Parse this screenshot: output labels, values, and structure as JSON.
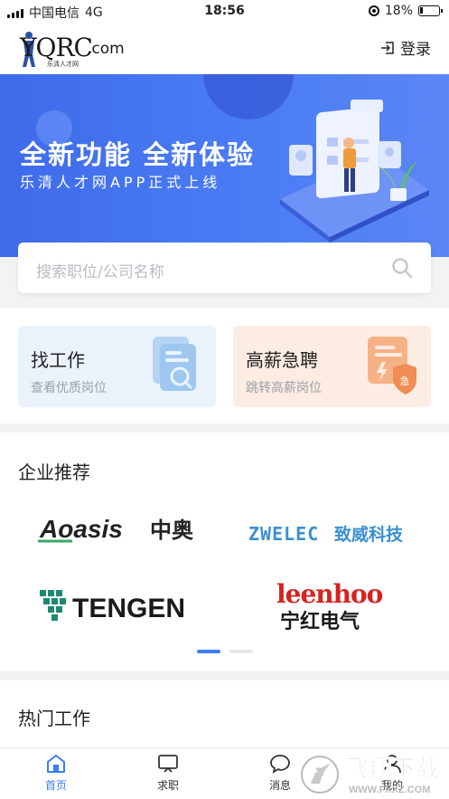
{
  "status_bar": {
    "carrier": "中国电信",
    "network": "4G",
    "time": "18:56",
    "battery": "18%",
    "battery_level": 0.18
  },
  "header": {
    "logo_mark": "YQRC",
    "logo_domain": ".com",
    "logo_sub": "乐清人才网",
    "login_label": "登录"
  },
  "banner": {
    "title": "全新功能  全新体验",
    "subtitle": "乐清人才网APP正式上线"
  },
  "search": {
    "placeholder": "搜索职位/公司名称"
  },
  "quick_entries": [
    {
      "title": "找工作",
      "subtitle": "查看优质岗位",
      "icon": "job-search-icon",
      "color": "#9ec8ef"
    },
    {
      "title": "高薪急聘",
      "subtitle": "跳转高薪岗位",
      "icon": "urgent-hire-icon",
      "color": "#f5a06b"
    }
  ],
  "companies": {
    "title": "企业推荐",
    "logos": [
      {
        "latin": "Aoasis",
        "cn": "中奥"
      },
      {
        "latin": "ZWELEC",
        "cn": "致威科技"
      },
      {
        "latin": "TENGEN",
        "cn": ""
      },
      {
        "latin": "leenhoo",
        "cn": "宁红电气"
      }
    ],
    "page_count": 2,
    "active_page": 0
  },
  "hot_jobs": {
    "title": "热门工作"
  },
  "tabbar": [
    {
      "label": "首页",
      "icon": "home-icon",
      "active": true
    },
    {
      "label": "求职",
      "icon": "job-seek-icon",
      "active": false
    },
    {
      "label": "消息",
      "icon": "message-icon",
      "active": false
    },
    {
      "label": "我的",
      "icon": "profile-icon",
      "active": false
    }
  ],
  "watermark": {
    "text": "飞翔下载",
    "url": "WWW.FXXZ.COM"
  },
  "colors": {
    "accent": "#3b7ef7",
    "banner": "#4a7cf4",
    "urgent_red": "#d6231f"
  }
}
